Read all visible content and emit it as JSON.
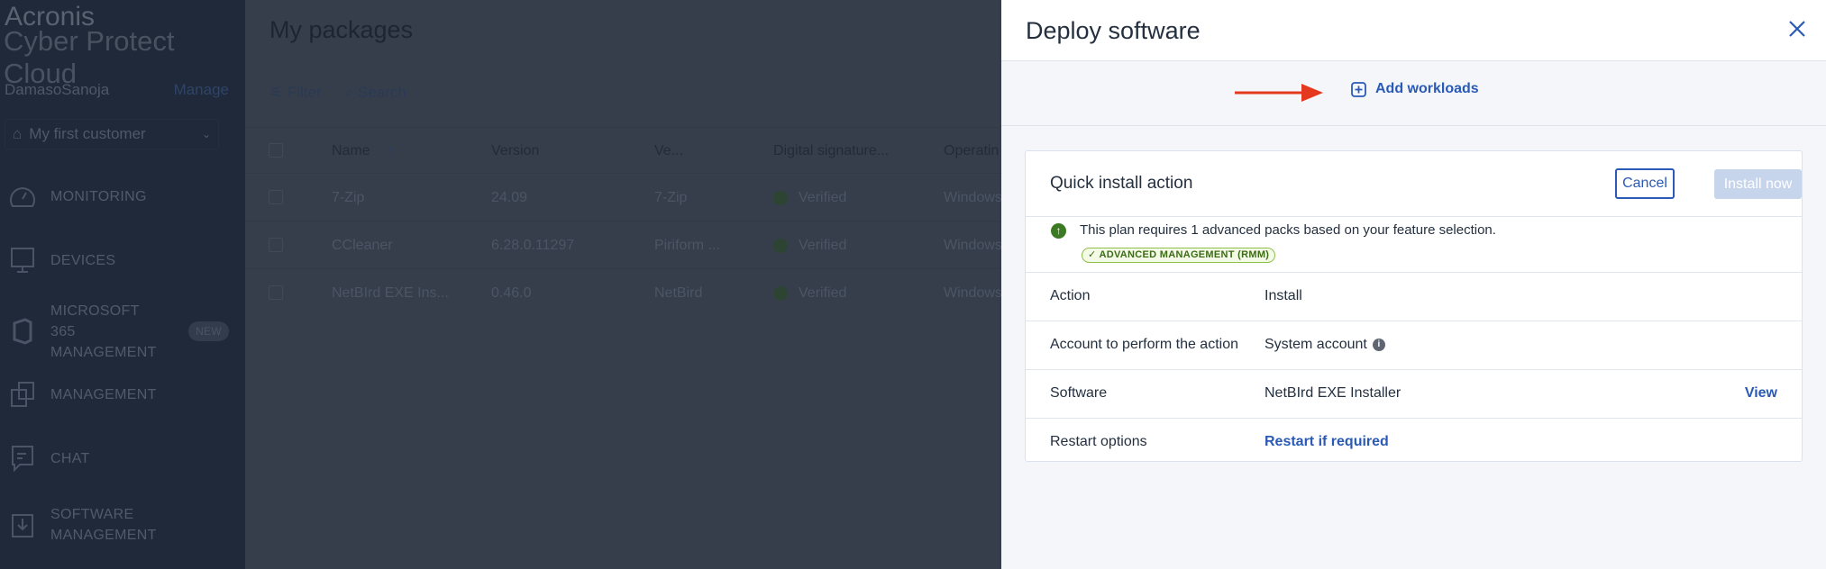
{
  "sidebar": {
    "brand_line1": "Acronis",
    "brand_line2": "Cyber Protect Cloud",
    "user": "DamasoSanoja",
    "manage": "Manage",
    "customer": "My first customer",
    "nav": [
      {
        "label": "MONITORING"
      },
      {
        "label": "DEVICES"
      },
      {
        "label": "MICROSOFT 365 MANAGEMENT",
        "badge": "NEW"
      },
      {
        "label": "MANAGEMENT"
      },
      {
        "label": "CHAT"
      },
      {
        "label": "SOFTWARE MANAGEMENT"
      }
    ]
  },
  "main": {
    "title": "My packages",
    "filter": "Filter",
    "search": "Search",
    "columns": [
      "Name",
      "Version",
      "Ve...",
      "Digital signature...",
      "Operatin"
    ],
    "rows": [
      {
        "name": "7-Zip",
        "version": "24.09",
        "vendor": "7-Zip",
        "signature": "Verified",
        "os": "Windows"
      },
      {
        "name": "CCleaner",
        "version": "6.28.0.11297",
        "vendor": "Piriform ...",
        "signature": "Verified",
        "os": "Windows"
      },
      {
        "name": "NetBIrd EXE Ins...",
        "version": "0.46.0",
        "vendor": "NetBird",
        "signature": "Verified",
        "os": "Windows"
      }
    ]
  },
  "panel": {
    "title": "Deploy software",
    "add_workloads": "Add workloads",
    "card": {
      "title": "Quick install action",
      "cancel": "Cancel",
      "install": "Install now",
      "promo_text": "This plan requires 1 advanced packs based on your feature selection.",
      "promo_badge": "ADVANCED MANAGEMENT (RMM)",
      "rows": [
        {
          "label": "Action",
          "value": "Install"
        },
        {
          "label": "Account to perform the action",
          "value": "System account"
        },
        {
          "label": "Software",
          "value": "NetBIrd EXE Installer",
          "link": "View"
        },
        {
          "label": "Restart options",
          "value": "Restart if required"
        }
      ]
    }
  },
  "colors": {
    "accent": "#2a5ab5",
    "arrow": "#e5391f",
    "success": "#3d7a24"
  }
}
